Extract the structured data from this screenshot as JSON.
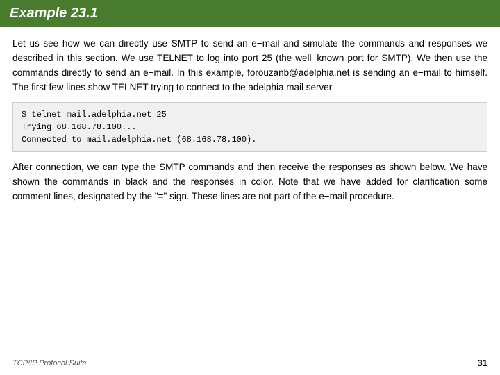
{
  "header": {
    "title": "Example 23.1",
    "bg_color": "#4a7c2f"
  },
  "main": {
    "paragraph1": "Let us see how we can directly use SMTP to send an e−mail and simulate the commands and responses we described in this section. We use TELNET to log into port 25 (the well−known port for SMTP). We then use the commands directly to send an e−mail. In this example, forouzanb@adelphia.net is sending an e−mail to himself. The first few lines show TELNET trying to connect to the adelphia mail server.",
    "code_lines": [
      "$ telnet mail.adelphia.net 25",
      "Trying 68.168.78.100...",
      "Connected to mail.adelphia.net (68.168.78.100)."
    ],
    "paragraph2": "After connection, we can type the SMTP commands and then receive the responses as shown below. We have shown the commands in black and the responses in color. Note that we have added for clarification some comment lines, designated by the \"=\" sign. These lines are not part of the e−mail procedure.",
    "footer_left": "TCP/IP Protocol Suite",
    "footer_right": "31"
  }
}
